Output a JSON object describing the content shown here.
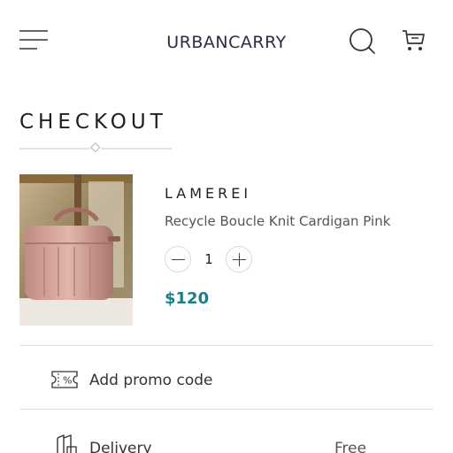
{
  "header": {
    "logo": "URBANCARRY",
    "menu_icon": "hamburger-menu-icon",
    "search_icon": "search-icon",
    "cart_icon": "cart-icon"
  },
  "checkout": {
    "title": "CHECKOUT"
  },
  "cart_item": {
    "brand": "LAMEREI",
    "name": "Recycle Boucle Knit Cardigan Pink",
    "quantity": "1",
    "price": "$120",
    "image": "pink-suitcase-photo"
  },
  "promo": {
    "label": "Add promo code",
    "icon": "promo-ticket-icon"
  },
  "delivery": {
    "label": "Delivery",
    "value": "Free",
    "icon": "delivery-icon"
  },
  "colors": {
    "price": "#1a7f87",
    "logo": "#2c2b46",
    "divider": "#dedede"
  }
}
